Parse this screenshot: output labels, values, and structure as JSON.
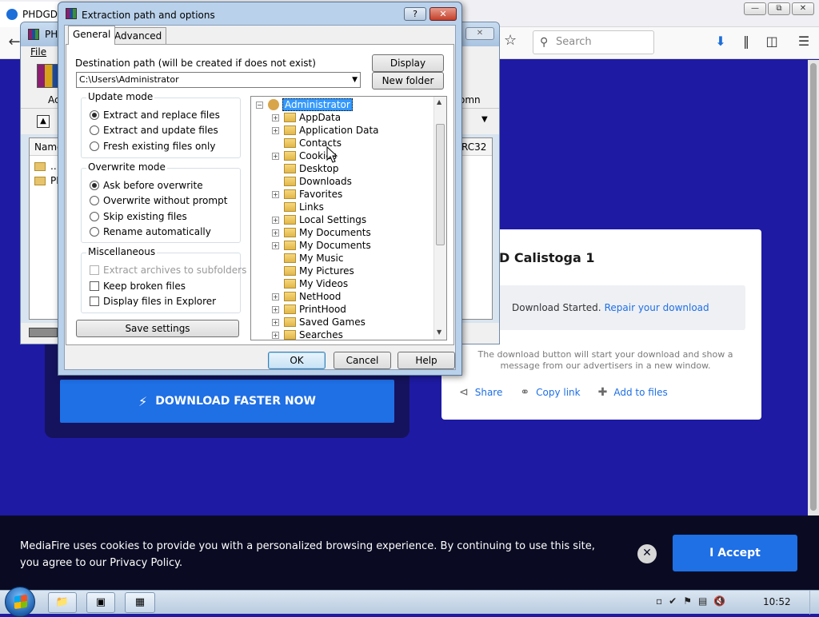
{
  "browser": {
    "tab_title": "PHDGD",
    "search_placeholder": "Search"
  },
  "page": {
    "download_faster_label": "DOWNLOAD FASTER NOW",
    "card_title": "D Calistoga 1",
    "download_started": "Download Started.",
    "repair_link": "Repair your download",
    "card_note": "The download button will start your download and show a message from our advertisers in a new window.",
    "share_label": "Share",
    "copy_link_label": "Copy link",
    "add_to_files_label": "Add to files"
  },
  "cookie": {
    "text": "MediaFire uses cookies to provide you with a personalized browsing experience. By continuing to use this site, you agree to our Privacy Policy.",
    "accept_label": "I Accept"
  },
  "taskbar": {
    "clock": "10:52"
  },
  "winrar": {
    "title": "PH",
    "menu_file": "File",
    "tool_add": "Ac",
    "tool_comment": "omn",
    "col_name": "Name",
    "col_crc": "RC32",
    "rows": [
      "..",
      "PH"
    ]
  },
  "dialog": {
    "title": "Extraction path and options",
    "tabs": [
      "General",
      "Advanced"
    ],
    "dest_label": "Destination path (will be created if does not exist)",
    "dest_value": "C:\\Users\\Administrator",
    "display_btn": "Display",
    "new_folder_btn": "New folder",
    "update_mode": {
      "title": "Update mode",
      "options": [
        "Extract and replace files",
        "Extract and update files",
        "Fresh existing files only"
      ],
      "selected": 0
    },
    "overwrite_mode": {
      "title": "Overwrite mode",
      "options": [
        "Ask before overwrite",
        "Overwrite without prompt",
        "Skip existing files",
        "Rename automatically"
      ],
      "selected": 0
    },
    "misc": {
      "title": "Miscellaneous",
      "options": [
        "Extract archives to subfolders",
        "Keep broken files",
        "Display files in Explorer"
      ]
    },
    "save_settings_btn": "Save settings",
    "tree": {
      "root": "Administrator",
      "items": [
        "AppData",
        "Application Data",
        "Contacts",
        "Cookies",
        "Desktop",
        "Downloads",
        "Favorites",
        "Links",
        "Local Settings",
        "My Documents",
        "My Documents",
        "My Music",
        "My Pictures",
        "My Videos",
        "NetHood",
        "PrintHood",
        "Saved Games",
        "Searches"
      ]
    },
    "ok_btn": "OK",
    "cancel_btn": "Cancel",
    "help_btn": "Help"
  }
}
